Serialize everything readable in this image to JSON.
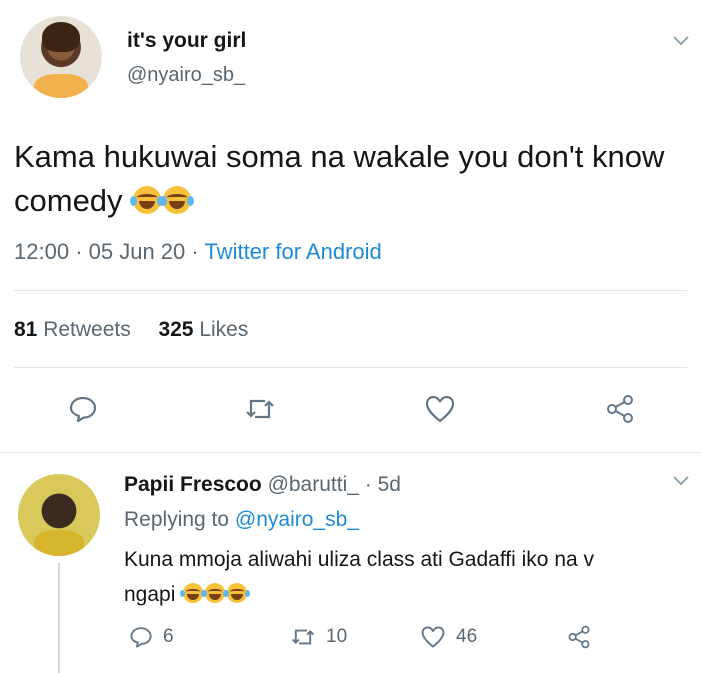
{
  "tweet": {
    "display_name": "it's your girl",
    "handle": "@nyairo_sb_",
    "text": "Kama hukuwai soma na wakale you don't know comedy",
    "emoji_count": 2,
    "time": "12:00",
    "date": "05 Jun 20",
    "source": "Twitter for Android",
    "retweets_count": "81",
    "retweets_label": "Retweets",
    "likes_count": "325",
    "likes_label": "Likes"
  },
  "reply": {
    "display_name": "Papii Frescoo",
    "handle": "@barutti_",
    "age": "5d",
    "replying_to_label": "Replying to",
    "replying_to_handle": "@nyairo_sb_",
    "text_line1": "Kuna mmoja aliwahi uliza class ati Gadaffi iko na v",
    "text_line2": "ngapi",
    "emoji_count": 3,
    "reply_count": "6",
    "retweet_count": "10",
    "like_count": "46"
  },
  "colors": {
    "link": "#1d8bd6",
    "secondary_text": "#5b6770",
    "primary_text": "#14171a",
    "divider": "#e1e6ea"
  },
  "icons": [
    "chevron-down-icon",
    "reply-icon",
    "retweet-icon",
    "heart-icon",
    "share-icon",
    "face-with-tears-of-joy-emoji"
  ]
}
